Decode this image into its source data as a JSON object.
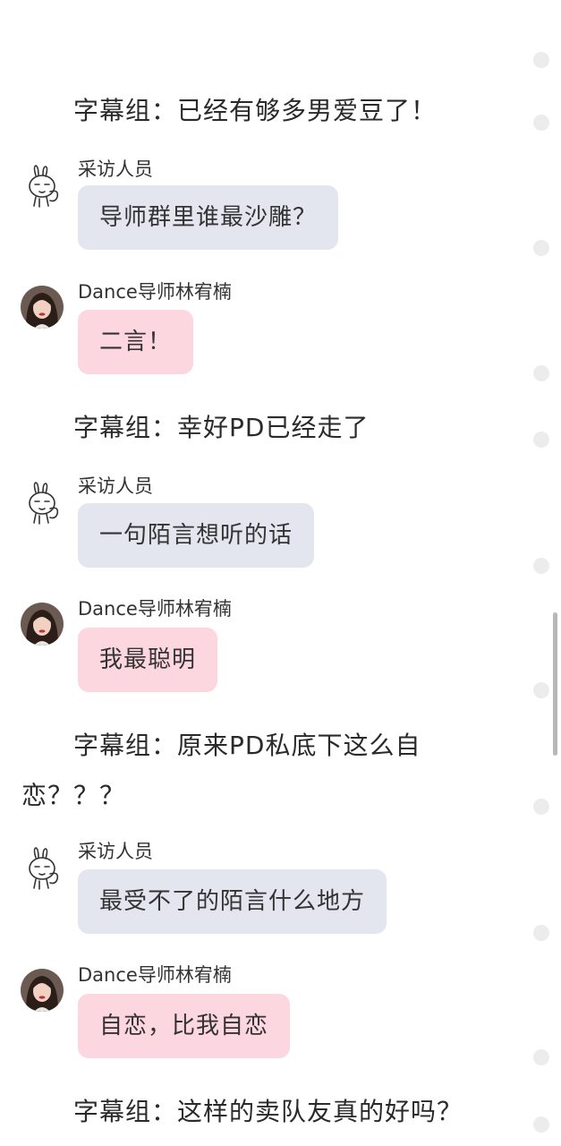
{
  "lines": [
    {
      "type": "narration",
      "text": "字幕组：已经有够多男爱豆了！"
    },
    {
      "type": "message",
      "speaker": "采访人员",
      "text": "导师群里谁最沙雕？",
      "style": "interviewer"
    },
    {
      "type": "message",
      "speaker": "Dance导师林宥楠",
      "text": "二言！",
      "style": "mentor"
    },
    {
      "type": "narration",
      "text": "字幕组：幸好PD已经走了"
    },
    {
      "type": "message",
      "speaker": "采访人员",
      "text": "一句陌言想听的话",
      "style": "interviewer"
    },
    {
      "type": "message",
      "speaker": "Dance导师林宥楠",
      "text": "我最聪明",
      "style": "mentor"
    },
    {
      "type": "narration",
      "text": "字幕组：原来PD私底下这么自",
      "continuation": "恋？？？"
    },
    {
      "type": "message",
      "speaker": "采访人员",
      "text": "最受不了的陌言什么地方",
      "style": "interviewer"
    },
    {
      "type": "message",
      "speaker": "Dance导师林宥楠",
      "text": "自恋，比我自恋",
      "style": "mentor"
    },
    {
      "type": "narration",
      "text": "字幕组：这样的卖队友真的好吗？"
    }
  ],
  "icons": {
    "interviewer_avatar": "bunny-doodle-icon",
    "mentor_avatar": "profile-photo"
  },
  "colors": {
    "interviewer_bubble": "#e3e6ef",
    "mentor_bubble": "#fdd7df",
    "background": "#ffffff"
  }
}
